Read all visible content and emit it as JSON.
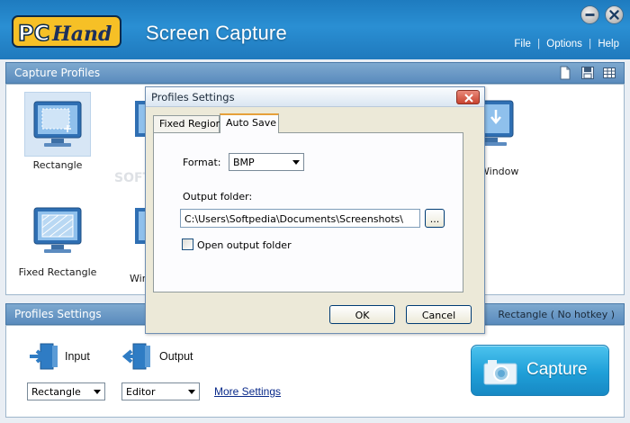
{
  "window": {
    "app_title": "Screen Capture",
    "logo_text": "PC Hand",
    "menu": [
      "File",
      "Options",
      "Help"
    ],
    "menu_separator": "|"
  },
  "capture_profiles": {
    "header": "Capture Profiles",
    "header_icons": [
      "new-profile-icon",
      "save-icon",
      "grid-view-icon"
    ],
    "items": [
      {
        "label": "Rectangle",
        "icon": "rectangle-monitor-icon",
        "selected": true
      },
      {
        "label": "Window",
        "icon": "window-monitor-icon",
        "selected": false
      },
      {
        "label": "Fixed Rectangle",
        "icon": "fixed-rectangle-monitor-icon",
        "selected": false
      },
      {
        "label": "Win",
        "icon": "monitor-icon",
        "selected": false
      }
    ]
  },
  "profiles_settings": {
    "header": "Profiles Settings",
    "current_profile": "Rectangle ( No hotkey )",
    "input_label": "Input",
    "output_label": "Output",
    "input_value": "Rectangle",
    "output_value": "Editor",
    "more_settings": "More Settings",
    "capture_button": "Capture"
  },
  "dialog": {
    "title": "Profiles Settings",
    "tabs": [
      "Fixed Region",
      "Auto Save"
    ],
    "active_tab": "Auto Save",
    "format_label": "Format:",
    "format_value": "BMP",
    "output_folder_label": "Output folder:",
    "output_folder_value": "C:\\Users\\Softpedia\\Documents\\Screenshots\\",
    "browse_label": "...",
    "open_folder_label": "Open output folder",
    "open_folder_checked": false,
    "ok_label": "OK",
    "cancel_label": "Cancel"
  },
  "colors": {
    "titlebar": "#1f7fc3",
    "panel_header": "#6a99c6",
    "capture_button": "#25a8e0",
    "dialog_bg": "#ece9d8"
  }
}
